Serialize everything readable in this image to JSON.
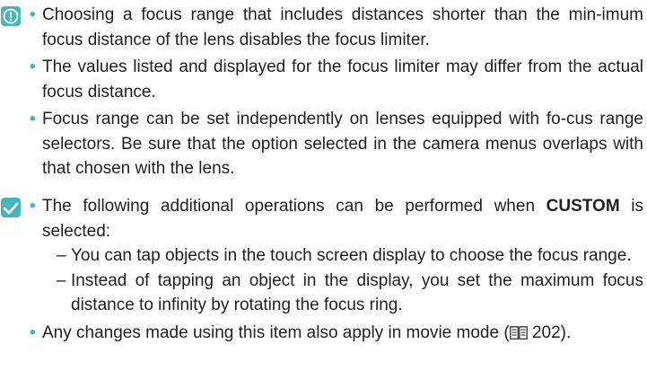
{
  "caution": {
    "icon": "caution-circle-icon",
    "accent": "#47b6b8",
    "items": [
      "Choosing a focus range that includes distances shorter than the min-imum focus distance of the lens disables the focus limiter.",
      "The values listed and displayed for the focus limiter may differ from the actual focus distance.",
      "Focus range can be set independently on lenses equipped with fo-cus range selectors. Be sure that the option selected in the camera menus overlaps with that chosen with the lens."
    ]
  },
  "tip": {
    "icon": "tip-check-icon",
    "accent": "#47b6b8",
    "item1_before": "The following additional operations can be performed when ",
    "item1_keyword": "CUSTOM",
    "item1_after": " is selected:",
    "subitems": [
      "You can tap objects in the touch screen display to choose the focus range.",
      "Instead of tapping an object in the display, you set the maximum focus distance to infinity by rotating the focus ring."
    ],
    "item2_before": "Any changes made using this item also apply in movie mode (",
    "item2_ref_icon": "book-page-ref-icon",
    "item2_page": "202",
    "item2_after": ")."
  },
  "bullet_char": "•",
  "dash_char": "–"
}
